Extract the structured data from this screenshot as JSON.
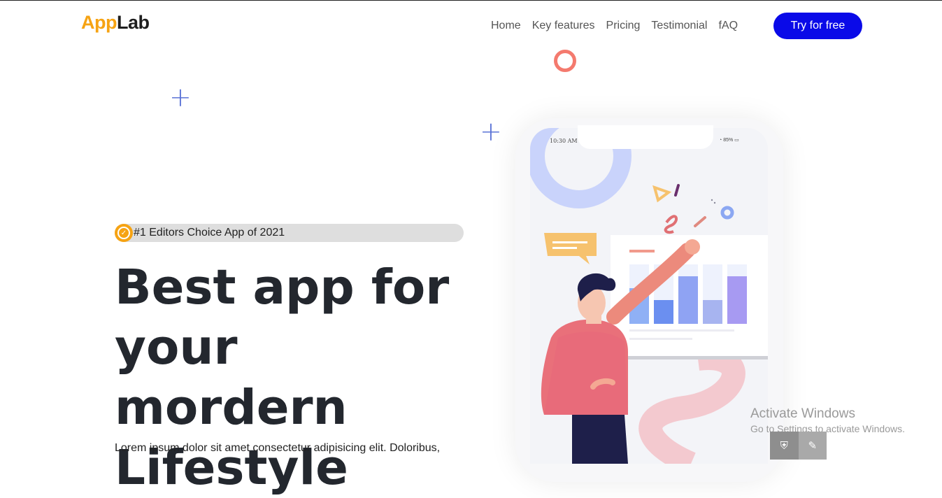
{
  "brand": {
    "logo_part1": "App",
    "logo_part2": "Lab",
    "accent": "#f6a313",
    "primary": "#0a0ae8"
  },
  "nav": {
    "items": [
      "Home",
      "Key features",
      "Pricing",
      "Testimonial",
      "fAQ"
    ]
  },
  "cta": {
    "label": "Try for free"
  },
  "badge": {
    "text": "#1 Editors Choice App of 2021",
    "icon": "check-circle-icon"
  },
  "hero": {
    "title_line1": "Best app for",
    "title_line2": "your mordern",
    "title_line3": "Lifestyle",
    "description": "Lorem ipsum dolor sit amet consectetur adipisicing elit. Doloribus,"
  },
  "phone": {
    "time": "10:30 AM",
    "battery": "85%"
  },
  "chart_data": {
    "type": "bar",
    "values": [
      3,
      2,
      4,
      2,
      4
    ],
    "note_colors": [
      "#8fb0f5",
      "#6b8ff0",
      "#8fa3f3",
      "#a7b4f0",
      "#a79af2"
    ]
  },
  "overlay": {
    "activate_title": "Activate Windows",
    "activate_sub": "Go to Settings to activate Windows."
  }
}
